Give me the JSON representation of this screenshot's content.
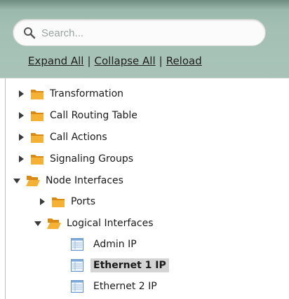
{
  "search": {
    "placeholder": "Search..."
  },
  "actions": {
    "expand_all": "Expand All",
    "collapse_all": "Collapse All",
    "reload": "Reload",
    "separator": "|"
  },
  "tree": {
    "transformation": "Transformation",
    "call_routing_table": "Call Routing Table",
    "call_actions": "Call Actions",
    "signaling_groups": "Signaling Groups",
    "node_interfaces": "Node Interfaces",
    "ports": "Ports",
    "logical_interfaces": "Logical Interfaces",
    "admin_ip": "Admin IP",
    "ethernet_1_ip": "Ethernet 1 IP",
    "ethernet_2_ip": "Ethernet 2 IP"
  },
  "selected_item": "Ethernet 1 IP",
  "colors": {
    "panel_bg": "#a3bfb3",
    "folder": "#f2a424",
    "selection": "#d4d4d4",
    "page_icon": "#5b8fc7"
  },
  "icons": {
    "collapsed_toggle": "triangle-right-icon",
    "expanded_toggle": "triangle-down-icon",
    "closed_folder": "folder-icon",
    "open_folder": "folder-open-icon",
    "leaf": "table-page-icon",
    "search": "search-icon"
  }
}
